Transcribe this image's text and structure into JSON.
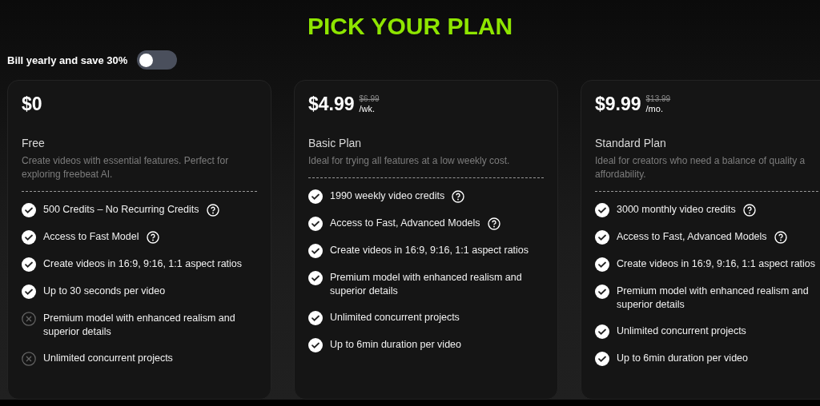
{
  "title": "PICK YOUR PLAN",
  "billing": {
    "label": "Bill yearly and save 30%",
    "on": false
  },
  "plans": [
    {
      "price": "$0",
      "name": "Free",
      "description": [
        "Create videos with essential features. Perfect for",
        "exploring freebeat AI."
      ],
      "features": [
        {
          "text": "500 Credits – No Recurring Credits",
          "kind": "included",
          "help": true
        },
        {
          "text": "Access to Fast Model",
          "kind": "included",
          "help": true
        },
        {
          "text": "Create videos in 16:9, 9:16, 1:1 aspect ratios",
          "kind": "included",
          "help": false
        },
        {
          "text": "Up to 30 seconds per video",
          "kind": "included",
          "help": false
        },
        {
          "text": "Premium model with enhanced realism and superior details",
          "kind": "excluded",
          "help": false
        },
        {
          "text": "Unlimited concurrent projects",
          "kind": "excluded",
          "help": false
        }
      ]
    },
    {
      "price": "$4.99",
      "old_price": "$6.99",
      "period": "/wk.",
      "name": "Basic Plan",
      "description": [
        "Ideal for trying all features at a low weekly cost."
      ],
      "features": [
        {
          "text": "1990 weekly video credits",
          "kind": "included",
          "help": true
        },
        {
          "text": "Access to Fast, Advanced Models",
          "kind": "included",
          "help": true
        },
        {
          "text": "Create videos in 16:9, 9:16, 1:1 aspect ratios",
          "kind": "included",
          "help": false
        },
        {
          "text": "Premium model with enhanced realism and superior details",
          "kind": "included",
          "help": false
        },
        {
          "text": "Unlimited concurrent projects",
          "kind": "included",
          "help": false
        },
        {
          "text": "Up to 6min duration per video",
          "kind": "included",
          "help": false
        }
      ]
    },
    {
      "price": "$9.99",
      "old_price": "$13.99",
      "period": "/mo.",
      "name": "Standard Plan",
      "description": [
        "Ideal for creators who need a balance of quality a",
        "affordability."
      ],
      "features": [
        {
          "text": "3000 monthly video credits",
          "kind": "included",
          "help": true
        },
        {
          "text": "Access to Fast, Advanced Models",
          "kind": "included",
          "help": true
        },
        {
          "text": "Create videos in 16:9, 9:16, 1:1 aspect ratios",
          "kind": "included",
          "help": false
        },
        {
          "text": "Premium model with enhanced realism and superior details",
          "kind": "included",
          "help": false
        },
        {
          "text": "Unlimited concurrent projects",
          "kind": "included",
          "help": false
        },
        {
          "text": "Up to 6min duration per video",
          "kind": "included",
          "help": false
        }
      ]
    }
  ]
}
